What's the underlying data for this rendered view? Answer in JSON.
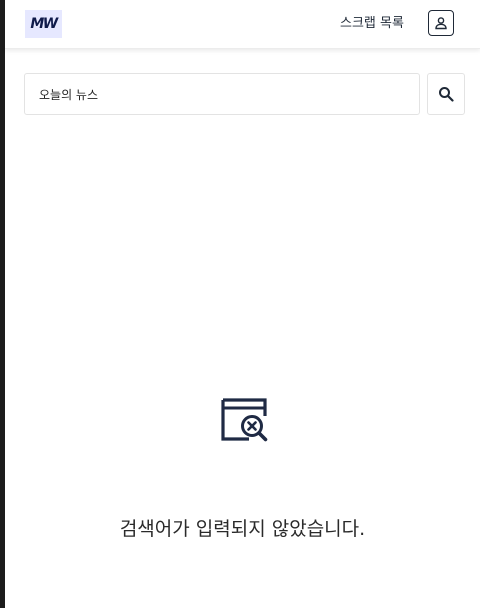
{
  "header": {
    "logo_text": "MW",
    "scrap_list_label": "스크랩 목록",
    "profile_icon": "user-icon"
  },
  "search": {
    "value": "오늘의 뉴스",
    "button_icon": "search-icon"
  },
  "empty_state": {
    "icon": "search-clear-window-icon",
    "message": "검색어가 입력되지 않았습니다."
  },
  "colors": {
    "logo_bg": "#e6e8ff",
    "logo_text": "#0f1a4a",
    "icon_dark": "#1f2a44"
  }
}
